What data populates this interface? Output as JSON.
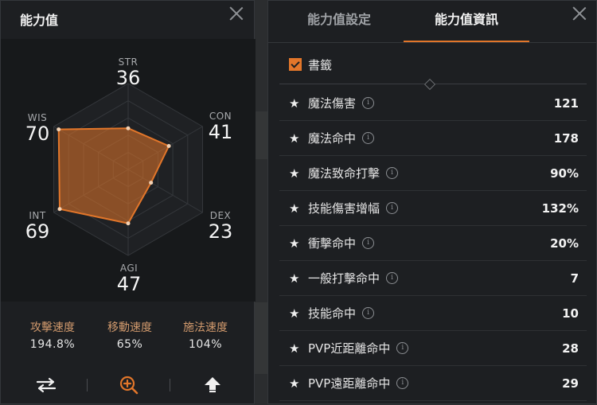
{
  "left": {
    "title": "能力值",
    "stats": {
      "str": {
        "name": "STR",
        "value": 36
      },
      "con": {
        "name": "CON",
        "value": 41
      },
      "dex": {
        "name": "DEX",
        "value": 23
      },
      "agi": {
        "name": "AGI",
        "value": 47
      },
      "int": {
        "name": "INT",
        "value": 69
      },
      "wis": {
        "name": "WIS",
        "value": 70
      }
    },
    "radar_max": 75,
    "accent_color": "#e2762a",
    "speeds": [
      {
        "label": "攻擊速度",
        "value": "194.8%"
      },
      {
        "label": "移動速度",
        "value": "65%"
      },
      {
        "label": "施法速度",
        "value": "104%"
      }
    ],
    "buttons": [
      "swap-icon",
      "zoom-icon",
      "upload-icon"
    ]
  },
  "right": {
    "tabs": [
      "能力值設定",
      "能力值資訊"
    ],
    "active_tab": 1,
    "bookmark_label": "書籤",
    "bookmark_checked": true,
    "rows": [
      {
        "name": "魔法傷害",
        "value": "121"
      },
      {
        "name": "魔法命中",
        "value": "178"
      },
      {
        "name": "魔法致命打擊",
        "value": "90%"
      },
      {
        "name": "技能傷害增幅",
        "value": "132%"
      },
      {
        "name": "衝擊命中",
        "value": "20%"
      },
      {
        "name": "一般打擊命中",
        "value": "7"
      },
      {
        "name": "技能命中",
        "value": "10"
      },
      {
        "name": "PVP近距離命中",
        "value": "28"
      },
      {
        "name": "PVP遠距離命中",
        "value": "29"
      }
    ]
  }
}
